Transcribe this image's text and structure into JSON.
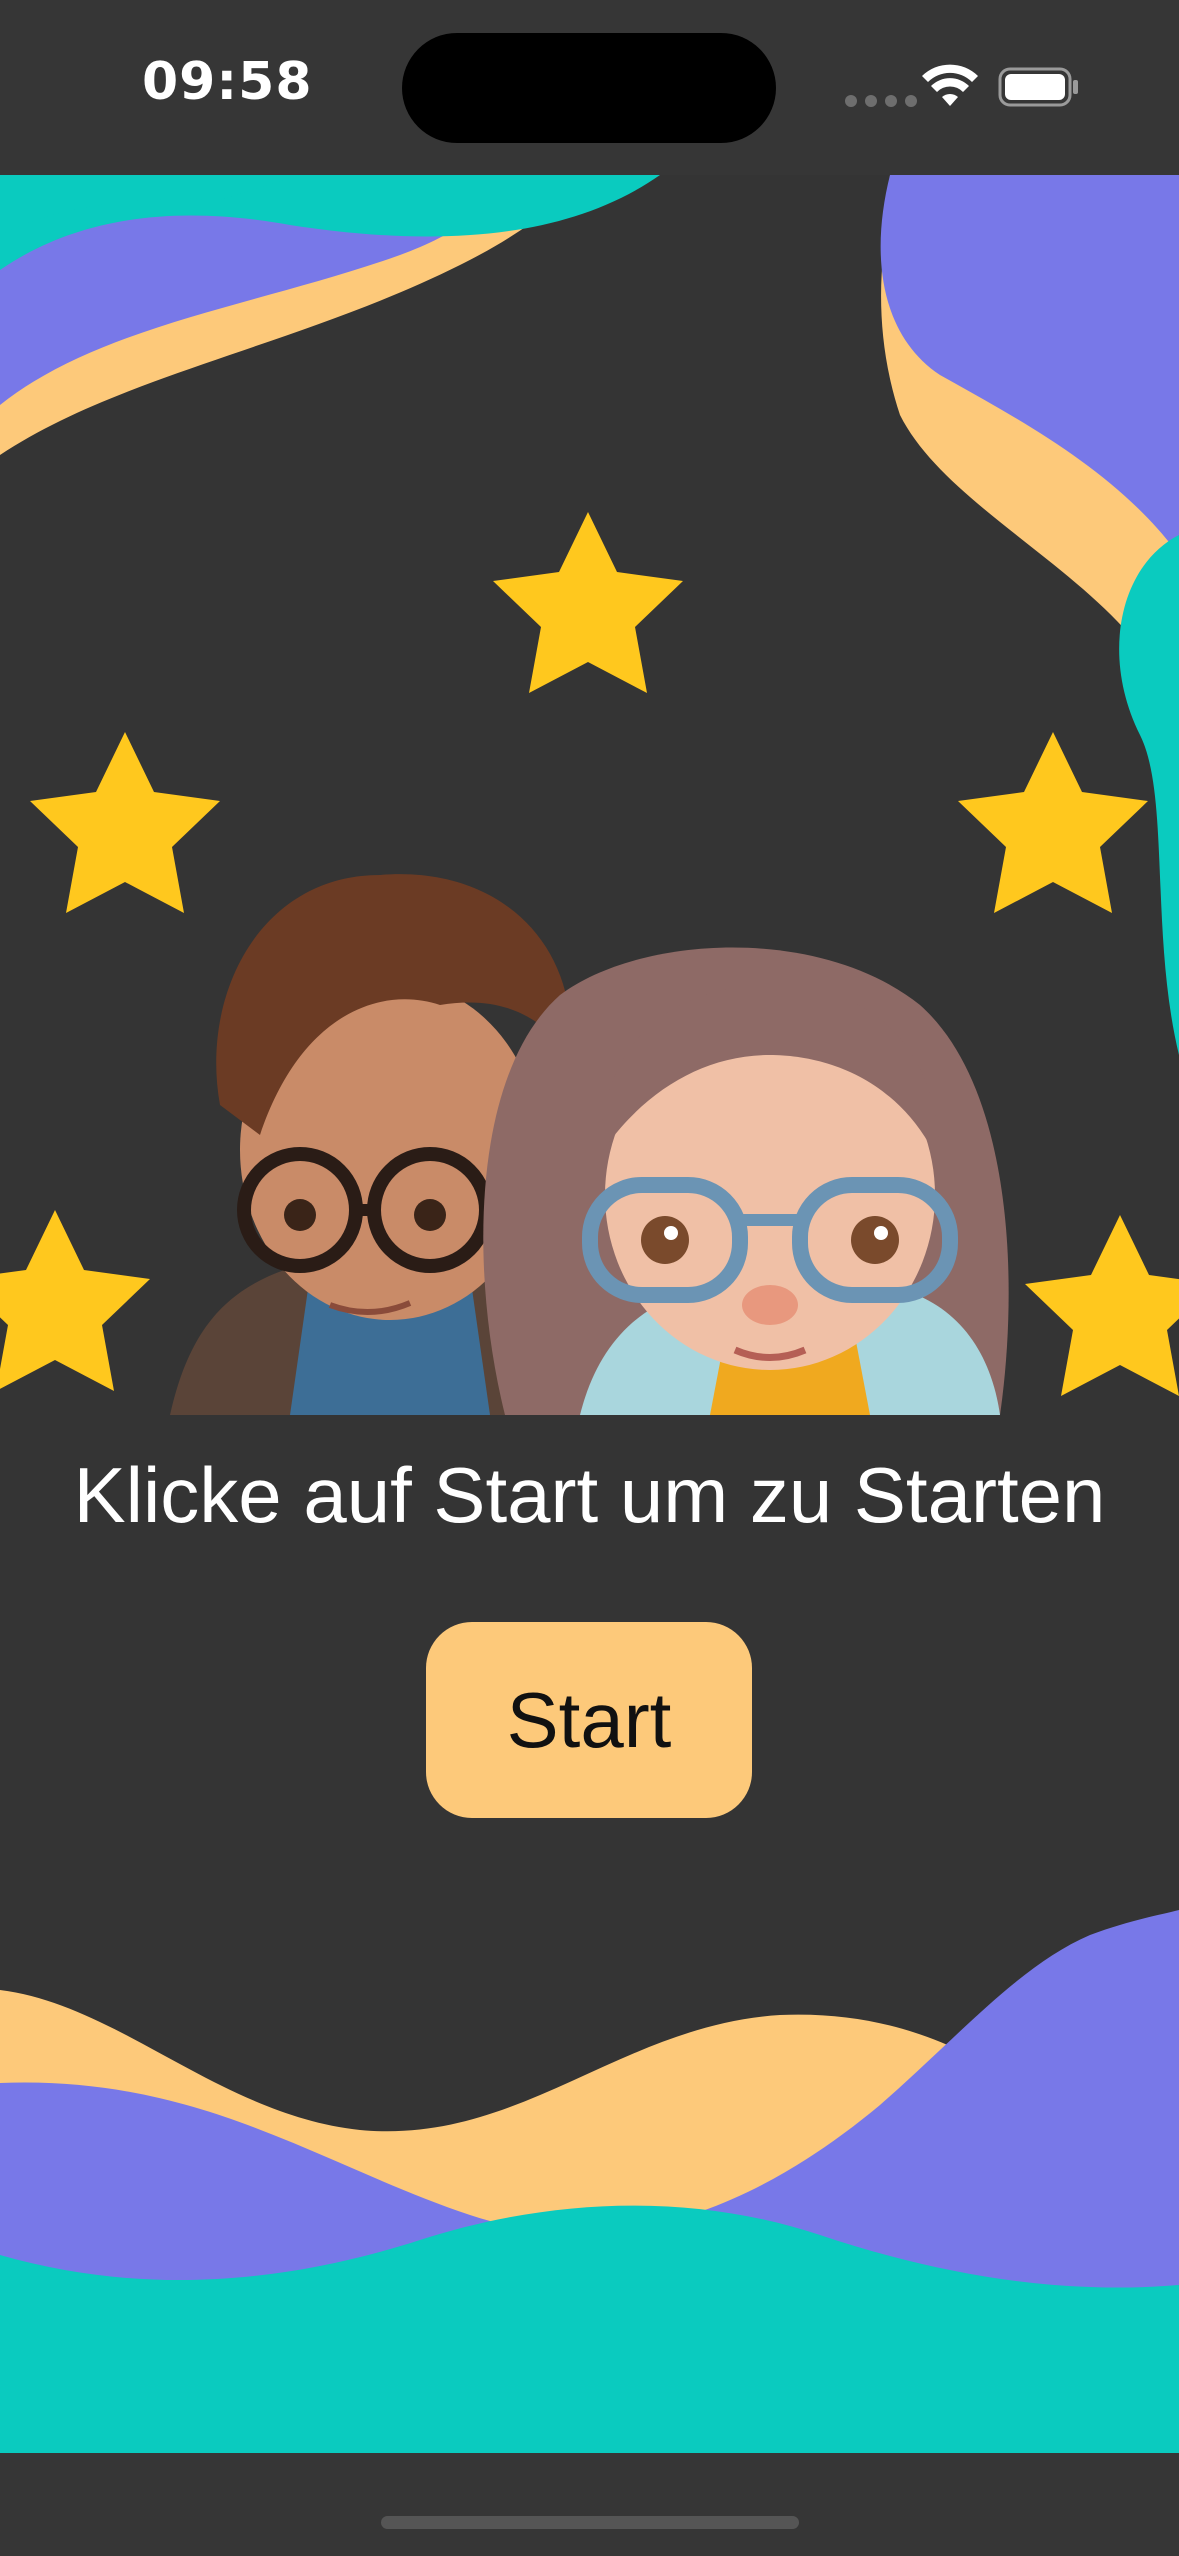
{
  "status_bar": {
    "time": "09:58"
  },
  "main": {
    "prompt": "Klicke auf Start um zu Starten",
    "start_label": "Start"
  },
  "illustration": {
    "subject": "two cartoon kids with glasses surrounded by stars",
    "icons": [
      "star-icon",
      "boy-avatar",
      "girl-avatar"
    ]
  },
  "colors": {
    "background": "#343434",
    "accent_yellow": "#FDC97A",
    "accent_purple": "#7878E8",
    "accent_teal": "#0ACBBF",
    "star": "#FFC81E"
  }
}
